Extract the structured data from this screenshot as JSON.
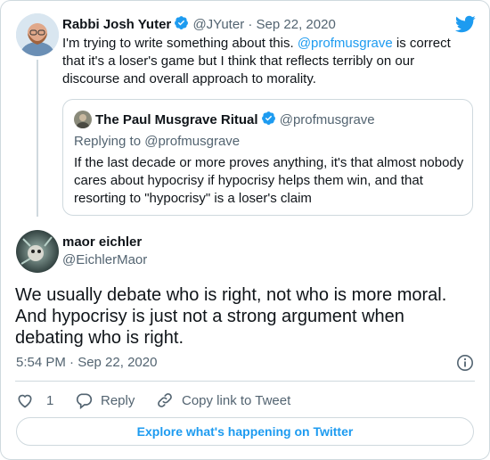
{
  "parent_tweet": {
    "author_name": "Rabbi Josh Yuter",
    "handle": "@JYuter",
    "separator": "·",
    "date": "Sep 22, 2020",
    "text_before": "I'm trying to write something about this. ",
    "mention": "@profmusgrave",
    "text_after": " is correct that it's a loser's game but I think that reflects terribly on our discourse and overall approach to morality.",
    "quoted": {
      "author_name": "The Paul Musgrave Ritual",
      "handle": "@profmusgrave",
      "replying_to": "Replying to @profmusgrave",
      "text": "If the last decade or more proves anything, it's that almost nobody cares about hypocrisy if hypocrisy helps them win, and that resorting to \"hypocrisy\" is a loser's claim"
    }
  },
  "main_tweet": {
    "author_name": "maor eichler",
    "handle": "@EichlerMaor",
    "text": "We usually debate who is right, not who is more moral. And hypocrisy is just not a strong argument when debating who is right.",
    "timestamp": "5:54 PM · Sep 22, 2020"
  },
  "actions": {
    "like_count": "1",
    "reply_label": "Reply",
    "copy_link_label": "Copy link to Tweet"
  },
  "explore_button": "Explore what's happening on Twitter",
  "colors": {
    "twitter_blue": "#1d9bf0",
    "verified": "#1d9bf0",
    "text": "#0f1419",
    "muted": "#536471",
    "border": "#cfd9de"
  },
  "icons": [
    "twitter-bird-icon",
    "verified-badge-icon",
    "info-icon",
    "heart-icon",
    "reply-icon",
    "link-icon"
  ]
}
